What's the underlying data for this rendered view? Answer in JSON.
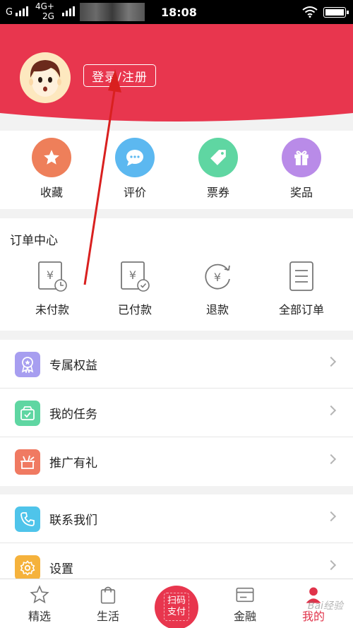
{
  "status_bar": {
    "carrier": "G",
    "net_top": "4G+",
    "net_bottom": "2G",
    "time": "18:08"
  },
  "header": {
    "login_label": "登录/注册",
    "bg_color": "#e8364e"
  },
  "quick_actions": [
    {
      "label": "收藏",
      "icon": "star-icon",
      "color": "#ee7f5a"
    },
    {
      "label": "评价",
      "icon": "chat-bubble-icon",
      "color": "#5cb8f0"
    },
    {
      "label": "票券",
      "icon": "ticket-tag-icon",
      "color": "#5fd6a2"
    },
    {
      "label": "奖品",
      "icon": "gift-icon",
      "color": "#b98be8"
    }
  ],
  "orders": {
    "title": "订单中心",
    "items": [
      {
        "label": "未付款",
        "icon": "yen-clock-icon"
      },
      {
        "label": "已付款",
        "icon": "yen-check-icon"
      },
      {
        "label": "退款",
        "icon": "yen-refund-icon"
      },
      {
        "label": "全部订单",
        "icon": "order-list-icon"
      }
    ]
  },
  "menu_group_1": [
    {
      "label": "专属权益",
      "icon": "badge-ribbon-icon",
      "color": "#a79ef0"
    },
    {
      "label": "我的任务",
      "icon": "task-box-icon",
      "color": "#5fd6a2"
    },
    {
      "label": "推广有礼",
      "icon": "gift-promo-icon",
      "color": "#f07a62"
    }
  ],
  "menu_group_2": [
    {
      "label": "联系我们",
      "icon": "phone-icon",
      "color": "#4fc4ea"
    },
    {
      "label": "设置",
      "icon": "gear-icon",
      "color": "#f5b23c"
    }
  ],
  "bottom_nav": {
    "items": [
      {
        "label": "精选",
        "icon": "star-outline-icon"
      },
      {
        "label": "生活",
        "icon": "shopping-bag-icon"
      },
      {
        "label": "金融",
        "icon": "card-icon"
      },
      {
        "label": "我的",
        "icon": "person-icon"
      }
    ],
    "scan_line1": "扫码",
    "scan_line2": "支付",
    "active_color": "#e0334a"
  },
  "watermark": "Bai经验"
}
